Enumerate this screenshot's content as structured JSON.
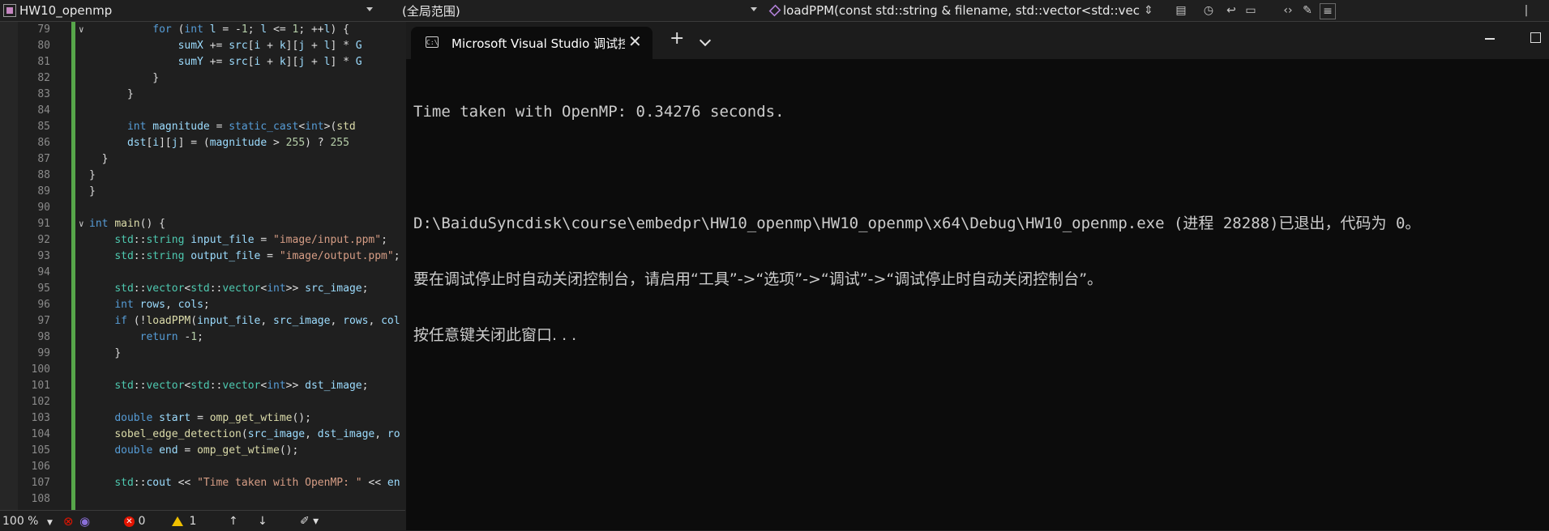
{
  "navbar": {
    "project": "HW10_openmp",
    "scope": "(全局范围)",
    "function": "loadPPM(const std::string & filename, std::vector<std::vec"
  },
  "editor": {
    "lines": [
      {
        "n": "79",
        "html": "          <span class=\"kw\">for</span> <span class=\"pl\">(</span><span class=\"kw\">int</span> <span class=\"id\">l</span> <span class=\"pl\">= -</span><span class=\"nm\">1</span><span class=\"pl\">;</span> <span class=\"id\">l</span> <span class=\"pl\">&lt;=</span> <span class=\"nm\">1</span><span class=\"pl\">;</span> <span class=\"pl\">++</span><span class=\"id\">l</span><span class=\"pl\">) {</span>"
      },
      {
        "n": "80",
        "html": "              <span class=\"id\">sumX</span> <span class=\"pl\">+=</span> <span class=\"id\">src</span><span class=\"pl\">[</span><span class=\"id\">i</span> <span class=\"pl\">+</span> <span class=\"id\">k</span><span class=\"pl\">][</span><span class=\"id\">j</span> <span class=\"pl\">+</span> <span class=\"id\">l</span><span class=\"pl\">] *</span> <span class=\"id\">G</span>"
      },
      {
        "n": "81",
        "html": "              <span class=\"id\">sumY</span> <span class=\"pl\">+=</span> <span class=\"id\">src</span><span class=\"pl\">[</span><span class=\"id\">i</span> <span class=\"pl\">+</span> <span class=\"id\">k</span><span class=\"pl\">][</span><span class=\"id\">j</span> <span class=\"pl\">+</span> <span class=\"id\">l</span><span class=\"pl\">] *</span> <span class=\"id\">G</span>"
      },
      {
        "n": "82",
        "html": "          <span class=\"pl\">}</span>"
      },
      {
        "n": "83",
        "html": "      <span class=\"pl\">}</span>"
      },
      {
        "n": "84",
        "html": ""
      },
      {
        "n": "85",
        "html": "      <span class=\"kw\">int</span> <span class=\"id\">magnitude</span> <span class=\"pl\">=</span> <span class=\"kw\">static_cast</span><span class=\"pl\">&lt;</span><span class=\"kw\">int</span><span class=\"pl\">&gt;(</span><span class=\"fn\">std</span>"
      },
      {
        "n": "86",
        "html": "      <span class=\"id\">dst</span><span class=\"pl\">[</span><span class=\"id\">i</span><span class=\"pl\">][</span><span class=\"id\">j</span><span class=\"pl\">] = (</span><span class=\"id\">magnitude</span> <span class=\"pl\">&gt;</span> <span class=\"nm\">255</span><span class=\"pl\">) ?</span> <span class=\"nm\">255</span>"
      },
      {
        "n": "87",
        "html": "  <span class=\"pl\">}</span>"
      },
      {
        "n": "88",
        "html": "<span class=\"pl\">}</span>"
      },
      {
        "n": "89",
        "html": "<span class=\"pl\">}</span>"
      },
      {
        "n": "90",
        "html": ""
      },
      {
        "n": "91",
        "html": "<span class=\"kw\">int</span> <span class=\"fn\">main</span><span class=\"pl\">() {</span>"
      },
      {
        "n": "92",
        "html": "    <span class=\"ty\">std</span><span class=\"pl\">::</span><span class=\"ty\">string</span> <span class=\"id\">input_file</span> <span class=\"pl\">=</span> <span class=\"st\">\"image/input.ppm\"</span><span class=\"pl\">;</span>"
      },
      {
        "n": "93",
        "html": "    <span class=\"ty\">std</span><span class=\"pl\">::</span><span class=\"ty\">string</span> <span class=\"id\">output_file</span> <span class=\"pl\">=</span> <span class=\"st\">\"image/output.ppm\"</span><span class=\"pl\">;</span>"
      },
      {
        "n": "94",
        "html": ""
      },
      {
        "n": "95",
        "html": "    <span class=\"ty\">std</span><span class=\"pl\">::</span><span class=\"ty\">vector</span><span class=\"pl\">&lt;</span><span class=\"ty\">std</span><span class=\"pl\">::</span><span class=\"ty\">vector</span><span class=\"pl\">&lt;</span><span class=\"kw\">int</span><span class=\"pl\">&gt;&gt;</span> <span class=\"id\">src_image</span><span class=\"pl\">;</span>"
      },
      {
        "n": "96",
        "html": "    <span class=\"kw\">int</span> <span class=\"id\">rows</span><span class=\"pl\">,</span> <span class=\"id\">cols</span><span class=\"pl\">;</span>"
      },
      {
        "n": "97",
        "html": "    <span class=\"kw\">if</span> <span class=\"pl\">(!</span><span class=\"fn\">loadPPM</span><span class=\"pl\">(</span><span class=\"id\">input_file</span><span class=\"pl\">,</span> <span class=\"id\">src_image</span><span class=\"pl\">,</span> <span class=\"id\">rows</span><span class=\"pl\">,</span> <span class=\"id\">col</span>"
      },
      {
        "n": "98",
        "html": "        <span class=\"kw\">return</span> <span class=\"pl\">-</span><span class=\"nm\">1</span><span class=\"pl\">;</span>"
      },
      {
        "n": "99",
        "html": "    <span class=\"pl\">}</span>"
      },
      {
        "n": "100",
        "html": ""
      },
      {
        "n": "101",
        "html": "    <span class=\"ty\">std</span><span class=\"pl\">::</span><span class=\"ty\">vector</span><span class=\"pl\">&lt;</span><span class=\"ty\">std</span><span class=\"pl\">::</span><span class=\"ty\">vector</span><span class=\"pl\">&lt;</span><span class=\"kw\">int</span><span class=\"pl\">&gt;&gt;</span> <span class=\"id\">dst_image</span><span class=\"pl\">;</span>"
      },
      {
        "n": "102",
        "html": ""
      },
      {
        "n": "103",
        "html": "    <span class=\"kw\">double</span> <span class=\"id\">start</span> <span class=\"pl\">=</span> <span class=\"fn\">omp_get_wtime</span><span class=\"pl\">();</span>"
      },
      {
        "n": "104",
        "html": "    <span class=\"fn\">sobel_edge_detection</span><span class=\"pl\">(</span><span class=\"id\">src_image</span><span class=\"pl\">,</span> <span class=\"id\">dst_image</span><span class=\"pl\">,</span> <span class=\"id\">ro</span>"
      },
      {
        "n": "105",
        "html": "    <span class=\"kw\">double</span> <span class=\"id\">end</span> <span class=\"pl\">=</span> <span class=\"fn\">omp_get_wtime</span><span class=\"pl\">();</span>"
      },
      {
        "n": "106",
        "html": ""
      },
      {
        "n": "107",
        "html": "    <span class=\"ty\">std</span><span class=\"pl\">::</span><span class=\"id\">cout</span> <span class=\"pl\">&lt;&lt;</span> <span class=\"st\">\"Time taken with OpenMP: \"</span> <span class=\"pl\">&lt;&lt;</span> <span class=\"id\">en</span>"
      },
      {
        "n": "108",
        "html": ""
      }
    ]
  },
  "statusbar": {
    "zoom": "100 %",
    "errors": "0",
    "warnings": "1"
  },
  "terminal": {
    "tab_title": "Microsoft Visual Studio 调试控制台",
    "output": [
      "Time taken with OpenMP: 0.34276 seconds.",
      "",
      "D:\\BaiduSyncdisk\\course\\embedpr\\HW10_openmp\\HW10_openmp\\x64\\Debug\\HW10_openmp.exe (进程 28288)已退出，代码为 0。",
      "要在调试停止时自动关闭控制台，请启用“工具”->“选项”->“调试”->“调试停止时自动关闭控制台”。",
      "按任意键关闭此窗口. . ."
    ]
  },
  "colors": {
    "editor_bg": "#1f1f1f",
    "terminal_bg": "#0c0c0c",
    "change_bar": "#57a64a",
    "keyword": "#569cd6",
    "type": "#4ec9b0",
    "string": "#d69d85"
  }
}
